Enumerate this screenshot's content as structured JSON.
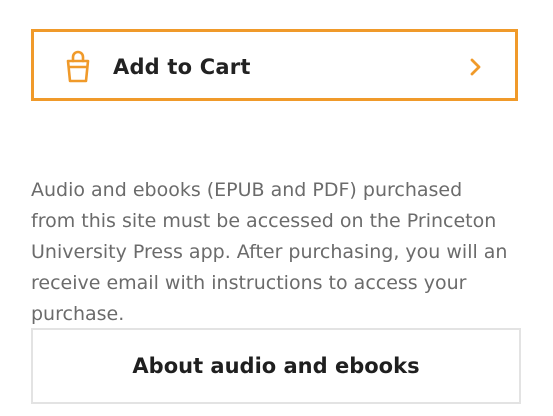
{
  "cart": {
    "label": "Add to Cart",
    "icon": "shopping-bag-icon",
    "chevron_icon": "chevron-right-icon",
    "accent_color": "#f09a2a"
  },
  "info": {
    "lines": [
      "Audio and ebooks (EPUB and PDF) purchased",
      "from this site must be accessed on the Princeton",
      "University Press app. After purchasing, you will an",
      "receive email with instructions to access your",
      "purchase."
    ]
  },
  "about": {
    "label": "About audio and ebooks"
  }
}
